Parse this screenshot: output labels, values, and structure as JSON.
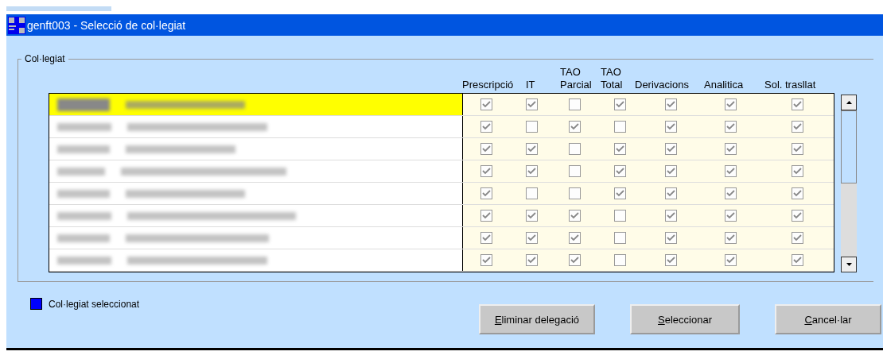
{
  "window": {
    "title": "genft003 - Selecció de col·legiat"
  },
  "group": {
    "label": "Col·legiat"
  },
  "columns": [
    {
      "lines": [
        "Prescripció"
      ]
    },
    {
      "lines": [
        "IT"
      ]
    },
    {
      "lines": [
        "TAO",
        "Parcial"
      ]
    },
    {
      "lines": [
        "TAO",
        "Total"
      ]
    },
    {
      "lines": [
        "Derivacions"
      ]
    },
    {
      "lines": [
        "Analitica"
      ]
    },
    {
      "lines": [
        "Sol. trasllat"
      ]
    }
  ],
  "rows": [
    {
      "selected": true,
      "checks": [
        true,
        true,
        false,
        true,
        true,
        true,
        true
      ]
    },
    {
      "selected": false,
      "checks": [
        true,
        false,
        true,
        false,
        true,
        true,
        true
      ]
    },
    {
      "selected": false,
      "checks": [
        true,
        true,
        false,
        true,
        true,
        true,
        true
      ]
    },
    {
      "selected": false,
      "checks": [
        true,
        true,
        false,
        true,
        true,
        true,
        true
      ]
    },
    {
      "selected": false,
      "checks": [
        true,
        false,
        false,
        true,
        true,
        true,
        true
      ]
    },
    {
      "selected": false,
      "checks": [
        true,
        true,
        true,
        false,
        true,
        true,
        true
      ]
    },
    {
      "selected": false,
      "checks": [
        true,
        true,
        true,
        false,
        true,
        true,
        true
      ]
    },
    {
      "selected": false,
      "checks": [
        true,
        true,
        true,
        false,
        true,
        true,
        true
      ]
    }
  ],
  "legend": {
    "label": "Col·legiat seleccionat",
    "color": "#0000ff"
  },
  "buttons": [
    "Eliminar delegació",
    "Seleccionar",
    "Cancel·lar"
  ]
}
